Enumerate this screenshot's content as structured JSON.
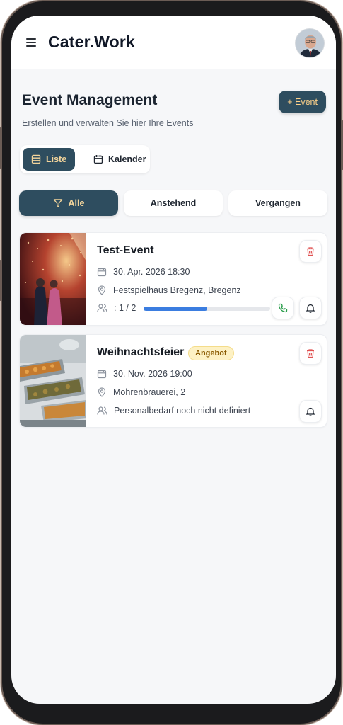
{
  "app": {
    "brand": "Cater.Work"
  },
  "page": {
    "title": "Event Management",
    "subtitle": "Erstellen und verwalten Sie hier Ihre Events",
    "add_event_label": "+ Event"
  },
  "view_toggle": {
    "list_label": "Liste",
    "calendar_label": "Kalender",
    "selected": "Liste"
  },
  "filters": {
    "all_label": "Alle",
    "upcoming_label": "Anstehend",
    "past_label": "Vergangen",
    "selected": "Alle"
  },
  "events": [
    {
      "title": "Test-Event",
      "datetime": "30. Apr. 2026 18:30",
      "location": "Festspielhaus Bregenz, Bregenz",
      "staff_text": ": 1 / 2",
      "staff_progress": 0.5,
      "icons": [
        "calendar-icon",
        "map-pin-icon",
        "users-icon",
        "trash-icon",
        "phone-icon",
        "bell-icon"
      ]
    },
    {
      "title": "Weihnachtsfeier",
      "badge": "Angebot",
      "datetime": "30. Nov. 2026 19:00",
      "location": "Mohrenbrauerei, 2",
      "staff_text": "Personalbedarf noch nicht definiert",
      "icons": [
        "calendar-icon",
        "map-pin-icon",
        "users-icon",
        "trash-icon",
        "bell-icon"
      ]
    }
  ],
  "colors": {
    "primary": "#2e4d5f",
    "accent_text": "#f2d49b",
    "progress": "#3b7de0",
    "delete": "#e05252",
    "phone": "#2a9d4b",
    "badge_bg": "#fdf1c4"
  }
}
